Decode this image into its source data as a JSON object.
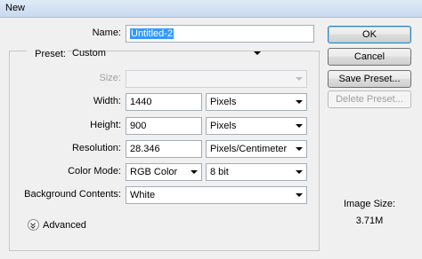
{
  "window": {
    "title": "New"
  },
  "form": {
    "name": {
      "label": "Name:",
      "value": "Untitled-2"
    },
    "preset": {
      "label": "Preset:",
      "value": "Custom"
    },
    "size": {
      "label": "Size:",
      "value": ""
    },
    "width": {
      "label": "Width:",
      "value": "1440",
      "unit": "Pixels"
    },
    "height": {
      "label": "Height:",
      "value": "900",
      "unit": "Pixels"
    },
    "resolution": {
      "label": "Resolution:",
      "value": "28.346",
      "unit": "Pixels/Centimeter"
    },
    "color_mode": {
      "label": "Color Mode:",
      "value": "RGB Color",
      "bit_depth": "8 bit"
    },
    "background": {
      "label": "Background Contents:",
      "value": "White"
    },
    "advanced": {
      "label": "Advanced"
    }
  },
  "buttons": {
    "ok": "OK",
    "cancel": "Cancel",
    "save_preset": "Save Preset...",
    "delete_preset": "Delete Preset..."
  },
  "image_size": {
    "label": "Image Size:",
    "value": "3.71M"
  },
  "colors": {
    "selection": "#3399ff",
    "default_button_border": "#3c7fb1"
  }
}
